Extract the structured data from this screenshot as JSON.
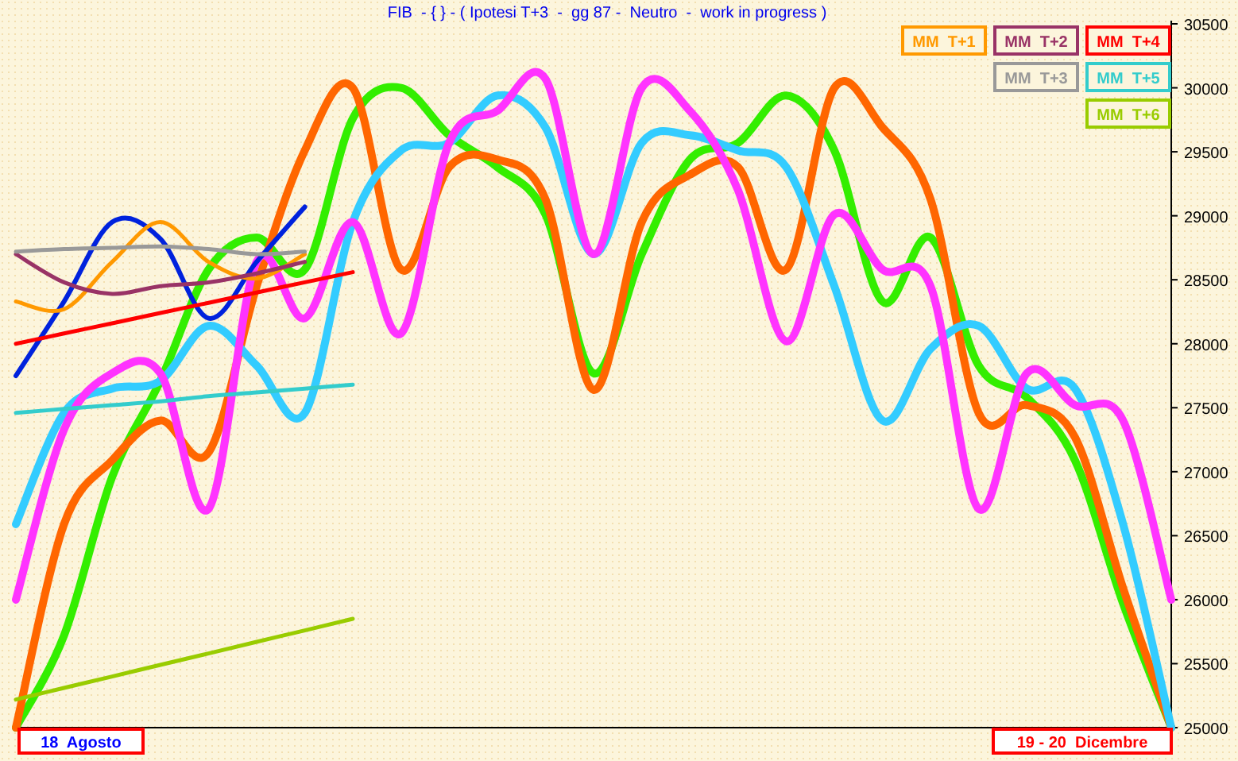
{
  "title": "FIB  - { } - ( Ipotesi T+3  -  gg 87 -  Neutro  -  work in progress )",
  "chart_data": {
    "type": "line",
    "ylim": [
      25000,
      30500
    ],
    "yticks": [
      25000,
      25500,
      26000,
      26500,
      27000,
      27500,
      28000,
      28500,
      29000,
      29500,
      30000,
      30500
    ],
    "series": [
      {
        "name": "MM  T+1",
        "color": "#ff9900",
        "values": [
          28330,
          28270,
          28640,
          28950,
          28640,
          28510,
          28700,
          null,
          null,
          null,
          null,
          null,
          null,
          null,
          null,
          null,
          null,
          null,
          null,
          null,
          null,
          null,
          null,
          null,
          null
        ]
      },
      {
        "name": "MM  T+2",
        "color": "#993366",
        "values": [
          28700,
          28480,
          28390,
          28450,
          28480,
          28550,
          28640,
          null,
          null,
          null,
          null,
          null,
          null,
          null,
          null,
          null,
          null,
          null,
          null,
          null,
          null,
          null,
          null,
          null,
          null
        ]
      },
      {
        "name": "MM  T+3",
        "color": "#999999",
        "values": [
          28720,
          28740,
          28750,
          28760,
          28740,
          28700,
          28720,
          null,
          null,
          null,
          null,
          null,
          null,
          null,
          null,
          null,
          null,
          null,
          null,
          null,
          null,
          null,
          null,
          null,
          null
        ]
      },
      {
        "name": "MM  T+4",
        "color": "#ff0000",
        "values": [
          28000,
          28080,
          28160,
          28240,
          28320,
          28400,
          28480,
          28560,
          null,
          null,
          null,
          null,
          null,
          null,
          null,
          null,
          null,
          null,
          null,
          null,
          null,
          null,
          null,
          null,
          null
        ]
      },
      {
        "name": "MM  T+5",
        "color": "#33cccc",
        "values": [
          27460,
          27490,
          27520,
          27550,
          27590,
          27620,
          27650,
          27680,
          null,
          null,
          null,
          null,
          null,
          null,
          null,
          null,
          null,
          null,
          null,
          null,
          null,
          null,
          null,
          null,
          null
        ]
      },
      {
        "name": "MM  T+6",
        "color": "#99cc00",
        "values": [
          25220,
          25310,
          25400,
          25490,
          25580,
          25670,
          25760,
          25850,
          null,
          null,
          null,
          null,
          null,
          null,
          null,
          null,
          null,
          null,
          null,
          null,
          null,
          null,
          null,
          null,
          null
        ]
      },
      {
        "color": "#33ee00",
        "values": [
          25000,
          25720,
          26960,
          27710,
          28580,
          28830,
          28580,
          29760,
          30000,
          29630,
          29380,
          29010,
          27770,
          28700,
          29440,
          29570,
          29940,
          29510,
          28330,
          28830,
          27830,
          27580,
          27090,
          25970,
          25000
        ]
      },
      {
        "color": "#ff6600",
        "values": [
          25000,
          26590,
          27090,
          27400,
          27150,
          28450,
          29510,
          30000,
          28580,
          29380,
          29440,
          29130,
          27640,
          28950,
          29320,
          29380,
          28580,
          30000,
          29690,
          29130,
          27460,
          27520,
          27270,
          26090,
          25000
        ]
      },
      {
        "color": "#33ccff",
        "values": [
          26590,
          27460,
          27650,
          27710,
          28140,
          27830,
          27460,
          28950,
          29510,
          29570,
          29940,
          29690,
          28700,
          29570,
          29630,
          29510,
          29380,
          28450,
          27400,
          27960,
          28140,
          27650,
          27650,
          26590,
          25000
        ]
      },
      {
        "color": "#ff33ff",
        "values": [
          26000,
          27330,
          27770,
          27770,
          26710,
          28640,
          28200,
          28950,
          28080,
          29570,
          29820,
          30070,
          28700,
          30000,
          29820,
          29200,
          28020,
          29010,
          28580,
          28450,
          26710,
          27770,
          27520,
          27400,
          26000
        ]
      },
      {
        "color": "#0022dd",
        "values": [
          27750,
          28330,
          28950,
          28820,
          28200,
          28640,
          29070,
          null,
          null,
          null,
          null,
          null,
          null,
          null,
          null,
          null,
          null,
          null,
          null,
          null,
          null,
          null,
          null,
          null,
          null
        ]
      }
    ]
  },
  "start_label": "18  Agosto",
  "end_label": "19 - 20  Dicembre"
}
